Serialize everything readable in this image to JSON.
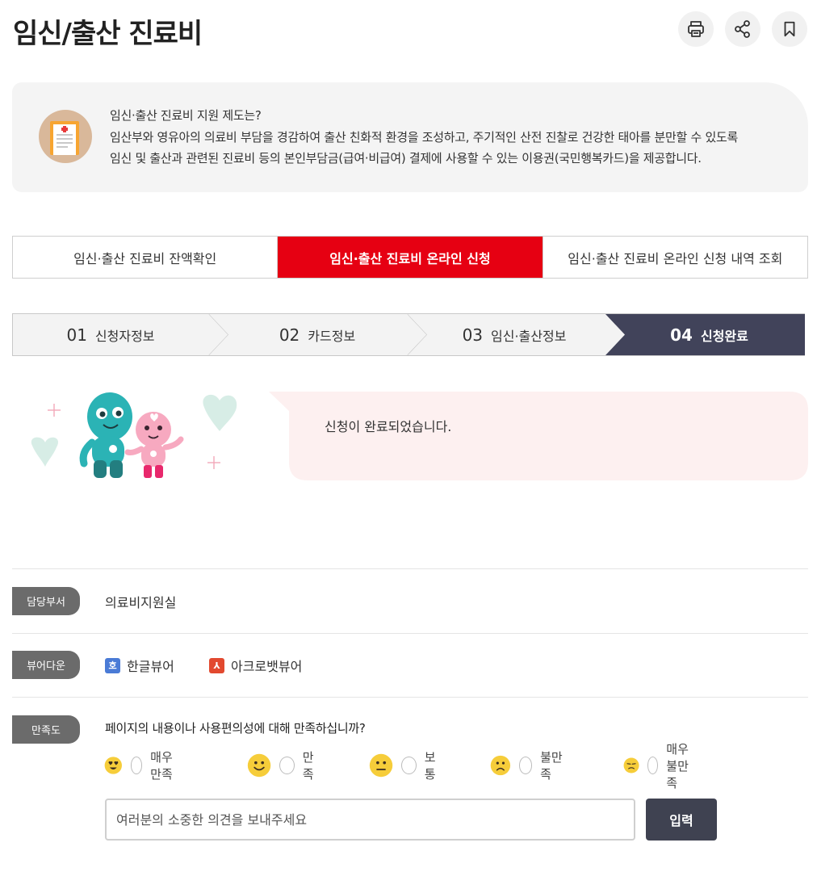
{
  "header": {
    "title": "임신/출산 진료비",
    "actions": [
      {
        "name": "print",
        "icon": "printer-icon"
      },
      {
        "name": "share",
        "icon": "share-icon"
      },
      {
        "name": "bookmark",
        "icon": "bookmark-icon"
      }
    ]
  },
  "info": {
    "lines": [
      "임신·출산 진료비 지원 제도는?",
      "임산부와 영유아의 의료비 부담을 경감하여 출산 친화적 환경을 조성하고, 주기적인 산전 진찰로 건강한 태아를 분만할 수 있도록",
      "임신 및 출산과 관련된 진료비 등의 본인부담금(급여·비급여) 결제에 사용할 수 있는 이용권(국민행복카드)을 제공합니다."
    ],
    "icon": "medical-document-icon"
  },
  "tabs": [
    {
      "label": "임신·출산 진료비 잔액확인",
      "active": false
    },
    {
      "label": "임신·출산 진료비 온라인 신청",
      "active": true
    },
    {
      "label": "임신·출산 진료비 온라인 신청 내역 조회",
      "active": false
    }
  ],
  "steps": [
    {
      "num": "01",
      "label": "신청자정보",
      "active": false
    },
    {
      "num": "02",
      "label": "카드정보",
      "active": false
    },
    {
      "num": "03",
      "label": "임신·출산정보",
      "active": false
    },
    {
      "num": "04",
      "label": "신청완료",
      "active": true
    }
  ],
  "completion": {
    "message": "신청이 완료되었습니다."
  },
  "department": {
    "badge": "담당부서",
    "value": "의료비지원실"
  },
  "viewer": {
    "badge": "뷰어다운",
    "items": [
      {
        "label": "한글뷰어",
        "icon": "hwp-file-icon",
        "glyph": "호"
      },
      {
        "label": "아크로뱃뷰어",
        "icon": "pdf-file-icon",
        "glyph": "⅄"
      }
    ]
  },
  "satisfaction": {
    "badge": "만족도",
    "question": "페이지의 내용이나 사용편의성에 대해 만족하십니까?",
    "options": [
      {
        "label": "매우만족",
        "face": "heart-eyes-face-icon"
      },
      {
        "label": "만족",
        "face": "smile-face-icon"
      },
      {
        "label": "보통",
        "face": "neutral-face-icon"
      },
      {
        "label": "불만족",
        "face": "frown-face-icon"
      },
      {
        "label": "매우불만족",
        "face": "unamused-face-icon"
      }
    ],
    "input_placeholder": "여러분의 소중한 의견을 보내주세요",
    "submit_label": "입력"
  },
  "colors": {
    "accent_red": "#e60012",
    "step_active": "#41435a",
    "badge_gray": "#6b6b6b",
    "bubble_pink": "#fdf0f0",
    "button_dark": "#3f4251",
    "face_yellow": "#f6cd3a"
  }
}
